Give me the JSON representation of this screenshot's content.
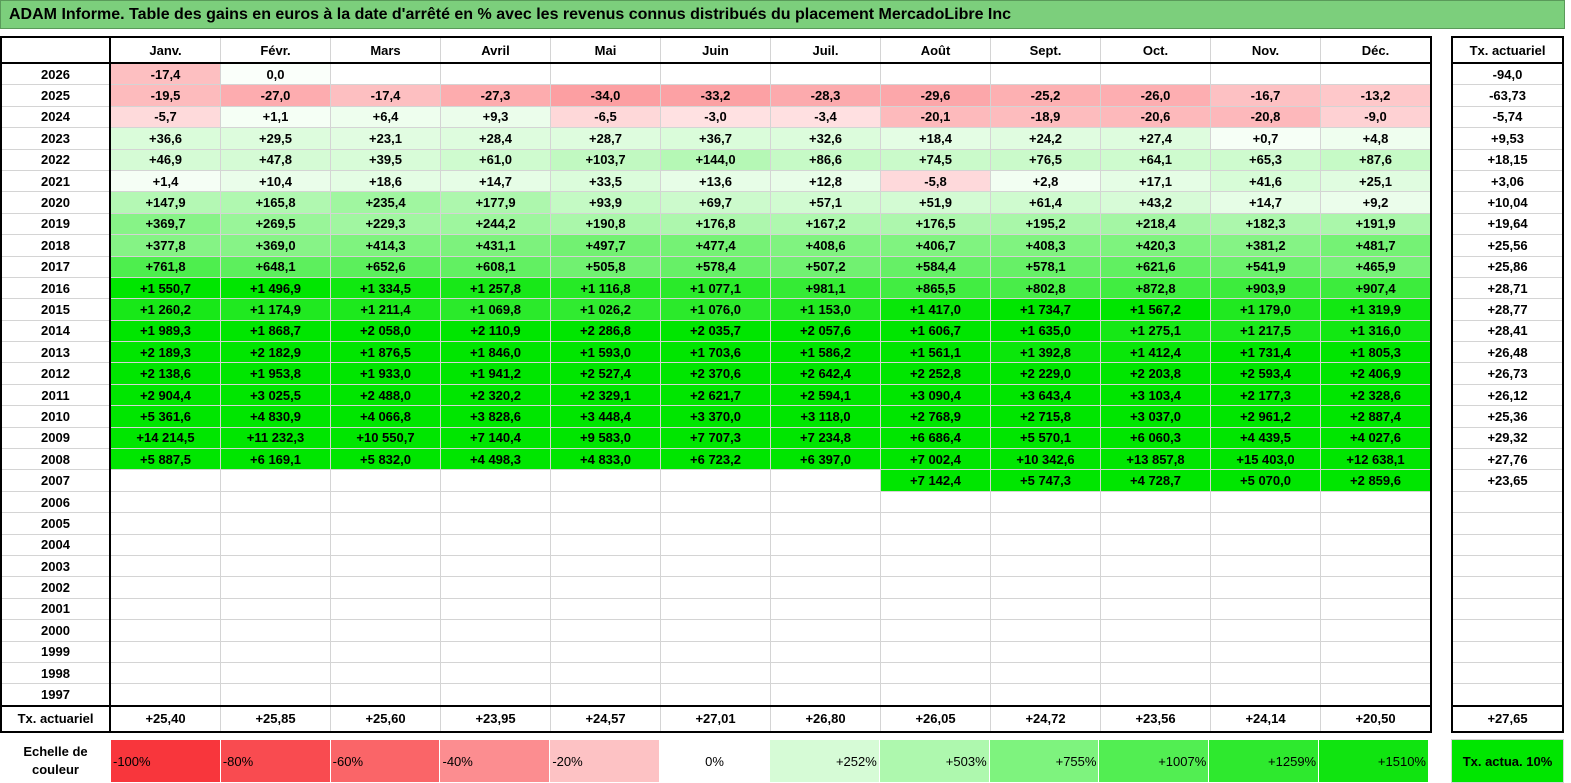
{
  "title": "ADAM Informe. Table des gains en euros à la date d'arrêté en % avec les revenus connus distribués du placement MercadoLibre Inc",
  "months": [
    "Janv.",
    "Févr.",
    "Mars",
    "Avril",
    "Mai",
    "Juin",
    "Juil.",
    "Août",
    "Sept.",
    "Oct.",
    "Nov.",
    "Déc."
  ],
  "side_header": "Tx. actuariel",
  "rows": [
    {
      "year": "2026",
      "values": [
        "-17,4",
        "0,0",
        "",
        "",
        "",
        "",
        "",
        "",
        "",
        "",
        "",
        ""
      ],
      "rate": "-94,0"
    },
    {
      "year": "2025",
      "values": [
        "-19,5",
        "-27,0",
        "-17,4",
        "-27,3",
        "-34,0",
        "-33,2",
        "-28,3",
        "-29,6",
        "-25,2",
        "-26,0",
        "-16,7",
        "-13,2"
      ],
      "rate": "-63,73"
    },
    {
      "year": "2024",
      "values": [
        "-5,7",
        "+1,1",
        "+6,4",
        "+9,3",
        "-6,5",
        "-3,0",
        "-3,4",
        "-20,1",
        "-18,9",
        "-20,6",
        "-20,8",
        "-9,0"
      ],
      "rate": "-5,74"
    },
    {
      "year": "2023",
      "values": [
        "+36,6",
        "+29,5",
        "+23,1",
        "+28,4",
        "+28,7",
        "+36,7",
        "+32,6",
        "+18,4",
        "+24,2",
        "+27,4",
        "+0,7",
        "+4,8"
      ],
      "rate": "+9,53"
    },
    {
      "year": "2022",
      "values": [
        "+46,9",
        "+47,8",
        "+39,5",
        "+61,0",
        "+103,7",
        "+144,0",
        "+86,6",
        "+74,5",
        "+76,5",
        "+64,1",
        "+65,3",
        "+87,6"
      ],
      "rate": "+18,15"
    },
    {
      "year": "2021",
      "values": [
        "+1,4",
        "+10,4",
        "+18,6",
        "+14,7",
        "+33,5",
        "+13,6",
        "+12,8",
        "-5,8",
        "+2,8",
        "+17,1",
        "+41,6",
        "+25,1"
      ],
      "rate": "+3,06"
    },
    {
      "year": "2020",
      "values": [
        "+147,9",
        "+165,8",
        "+235,4",
        "+177,9",
        "+93,9",
        "+69,7",
        "+57,1",
        "+51,9",
        "+61,4",
        "+43,2",
        "+14,7",
        "+9,2"
      ],
      "rate": "+10,04"
    },
    {
      "year": "2019",
      "values": [
        "+369,7",
        "+269,5",
        "+229,3",
        "+244,2",
        "+190,8",
        "+176,8",
        "+167,2",
        "+176,5",
        "+195,2",
        "+218,4",
        "+182,3",
        "+191,9"
      ],
      "rate": "+19,64"
    },
    {
      "year": "2018",
      "values": [
        "+377,8",
        "+369,0",
        "+414,3",
        "+431,1",
        "+497,7",
        "+477,4",
        "+408,6",
        "+406,7",
        "+408,3",
        "+420,3",
        "+381,2",
        "+481,7"
      ],
      "rate": "+25,56"
    },
    {
      "year": "2017",
      "values": [
        "+761,8",
        "+648,1",
        "+652,6",
        "+608,1",
        "+505,8",
        "+578,4",
        "+507,2",
        "+584,4",
        "+578,1",
        "+621,6",
        "+541,9",
        "+465,9"
      ],
      "rate": "+25,86"
    },
    {
      "year": "2016",
      "values": [
        "+1 550,7",
        "+1 496,9",
        "+1 334,5",
        "+1 257,8",
        "+1 116,8",
        "+1 077,1",
        "+981,1",
        "+865,5",
        "+802,8",
        "+872,8",
        "+903,9",
        "+907,4"
      ],
      "rate": "+28,71"
    },
    {
      "year": "2015",
      "values": [
        "+1 260,2",
        "+1 174,9",
        "+1 211,4",
        "+1 069,8",
        "+1 026,2",
        "+1 076,0",
        "+1 153,0",
        "+1 417,0",
        "+1 734,7",
        "+1 567,2",
        "+1 179,0",
        "+1 319,9"
      ],
      "rate": "+28,77"
    },
    {
      "year": "2014",
      "values": [
        "+1 989,3",
        "+1 868,7",
        "+2 058,0",
        "+2 110,9",
        "+2 286,8",
        "+2 035,7",
        "+2 057,6",
        "+1 606,7",
        "+1 635,0",
        "+1 275,1",
        "+1 217,5",
        "+1 316,0"
      ],
      "rate": "+28,41"
    },
    {
      "year": "2013",
      "values": [
        "+2 189,3",
        "+2 182,9",
        "+1 876,5",
        "+1 846,0",
        "+1 593,0",
        "+1 703,6",
        "+1 586,2",
        "+1 561,1",
        "+1 392,8",
        "+1 412,4",
        "+1 731,4",
        "+1 805,3"
      ],
      "rate": "+26,48"
    },
    {
      "year": "2012",
      "values": [
        "+2 138,6",
        "+1 953,8",
        "+1 933,0",
        "+1 941,2",
        "+2 527,4",
        "+2 370,6",
        "+2 642,4",
        "+2 252,8",
        "+2 229,0",
        "+2 203,8",
        "+2 593,4",
        "+2 406,9"
      ],
      "rate": "+26,73"
    },
    {
      "year": "2011",
      "values": [
        "+2 904,4",
        "+3 025,5",
        "+2 488,0",
        "+2 320,2",
        "+2 329,1",
        "+2 621,7",
        "+2 594,1",
        "+3 090,4",
        "+3 643,4",
        "+3 103,4",
        "+2 177,3",
        "+2 328,6"
      ],
      "rate": "+26,12"
    },
    {
      "year": "2010",
      "values": [
        "+5 361,6",
        "+4 830,9",
        "+4 066,8",
        "+3 828,6",
        "+3 448,4",
        "+3 370,0",
        "+3 118,0",
        "+2 768,9",
        "+2 715,8",
        "+3 037,0",
        "+2 961,2",
        "+2 887,4"
      ],
      "rate": "+25,36"
    },
    {
      "year": "2009",
      "values": [
        "+14 214,5",
        "+11 232,3",
        "+10 550,7",
        "+7 140,4",
        "+9 583,0",
        "+7 707,3",
        "+7 234,8",
        "+6 686,4",
        "+5 570,1",
        "+6 060,3",
        "+4 439,5",
        "+4 027,6"
      ],
      "rate": "+29,32"
    },
    {
      "year": "2008",
      "values": [
        "+5 887,5",
        "+6 169,1",
        "+5 832,0",
        "+4 498,3",
        "+4 833,0",
        "+6 723,2",
        "+6 397,0",
        "+7 002,4",
        "+10 342,6",
        "+13 857,8",
        "+15 403,0",
        "+12 638,1"
      ],
      "rate": "+27,76"
    },
    {
      "year": "2007",
      "values": [
        "",
        "",
        "",
        "",
        "",
        "",
        "",
        "+7 142,4",
        "+5 747,3",
        "+4 728,7",
        "+5 070,0",
        "+2 859,6"
      ],
      "rate": "+23,65"
    },
    {
      "year": "2006",
      "values": [
        "",
        "",
        "",
        "",
        "",
        "",
        "",
        "",
        "",
        "",
        "",
        ""
      ],
      "rate": ""
    },
    {
      "year": "2005",
      "values": [
        "",
        "",
        "",
        "",
        "",
        "",
        "",
        "",
        "",
        "",
        "",
        ""
      ],
      "rate": ""
    },
    {
      "year": "2004",
      "values": [
        "",
        "",
        "",
        "",
        "",
        "",
        "",
        "",
        "",
        "",
        "",
        ""
      ],
      "rate": ""
    },
    {
      "year": "2003",
      "values": [
        "",
        "",
        "",
        "",
        "",
        "",
        "",
        "",
        "",
        "",
        "",
        ""
      ],
      "rate": ""
    },
    {
      "year": "2002",
      "values": [
        "",
        "",
        "",
        "",
        "",
        "",
        "",
        "",
        "",
        "",
        "",
        ""
      ],
      "rate": ""
    },
    {
      "year": "2001",
      "values": [
        "",
        "",
        "",
        "",
        "",
        "",
        "",
        "",
        "",
        "",
        "",
        ""
      ],
      "rate": ""
    },
    {
      "year": "2000",
      "values": [
        "",
        "",
        "",
        "",
        "",
        "",
        "",
        "",
        "",
        "",
        "",
        ""
      ],
      "rate": ""
    },
    {
      "year": "1999",
      "values": [
        "",
        "",
        "",
        "",
        "",
        "",
        "",
        "",
        "",
        "",
        "",
        ""
      ],
      "rate": ""
    },
    {
      "year": "1998",
      "values": [
        "",
        "",
        "",
        "",
        "",
        "",
        "",
        "",
        "",
        "",
        "",
        ""
      ],
      "rate": ""
    },
    {
      "year": "1997",
      "values": [
        "",
        "",
        "",
        "",
        "",
        "",
        "",
        "",
        "",
        "",
        "",
        ""
      ],
      "rate": ""
    }
  ],
  "footer": {
    "label": "Tx. actuariel",
    "values": [
      "+25,40",
      "+25,85",
      "+25,60",
      "+23,95",
      "+24,57",
      "+27,01",
      "+26,80",
      "+26,05",
      "+24,72",
      "+23,56",
      "+24,14",
      "+20,50"
    ],
    "total": "+27,65"
  },
  "legend": {
    "label": "Echelle de couleur",
    "steps": [
      {
        "text": "-100%",
        "color": "#f8363c"
      },
      {
        "text": "-80%",
        "color": "#f94b50"
      },
      {
        "text": "-60%",
        "color": "#fa6568"
      },
      {
        "text": "-40%",
        "color": "#fc8d90"
      },
      {
        "text": "-20%",
        "color": "#fdc2c4"
      },
      {
        "text": "0%",
        "color": "#ffffff"
      },
      {
        "text": "+252%",
        "color": "#d6fbd6"
      },
      {
        "text": "+503%",
        "color": "#aef8ae"
      },
      {
        "text": "+755%",
        "color": "#7ef37e"
      },
      {
        "text": "+1007%",
        "color": "#52ee52"
      },
      {
        "text": "+1259%",
        "color": "#2ee92e"
      },
      {
        "text": "+1510%",
        "color": "#10e410"
      }
    ],
    "side_text": "Tx. actua. 10%"
  },
  "colors": {
    "title_bg": "#7ccf7c",
    "max_green": "#00e600",
    "max_red": "#f8363c"
  }
}
